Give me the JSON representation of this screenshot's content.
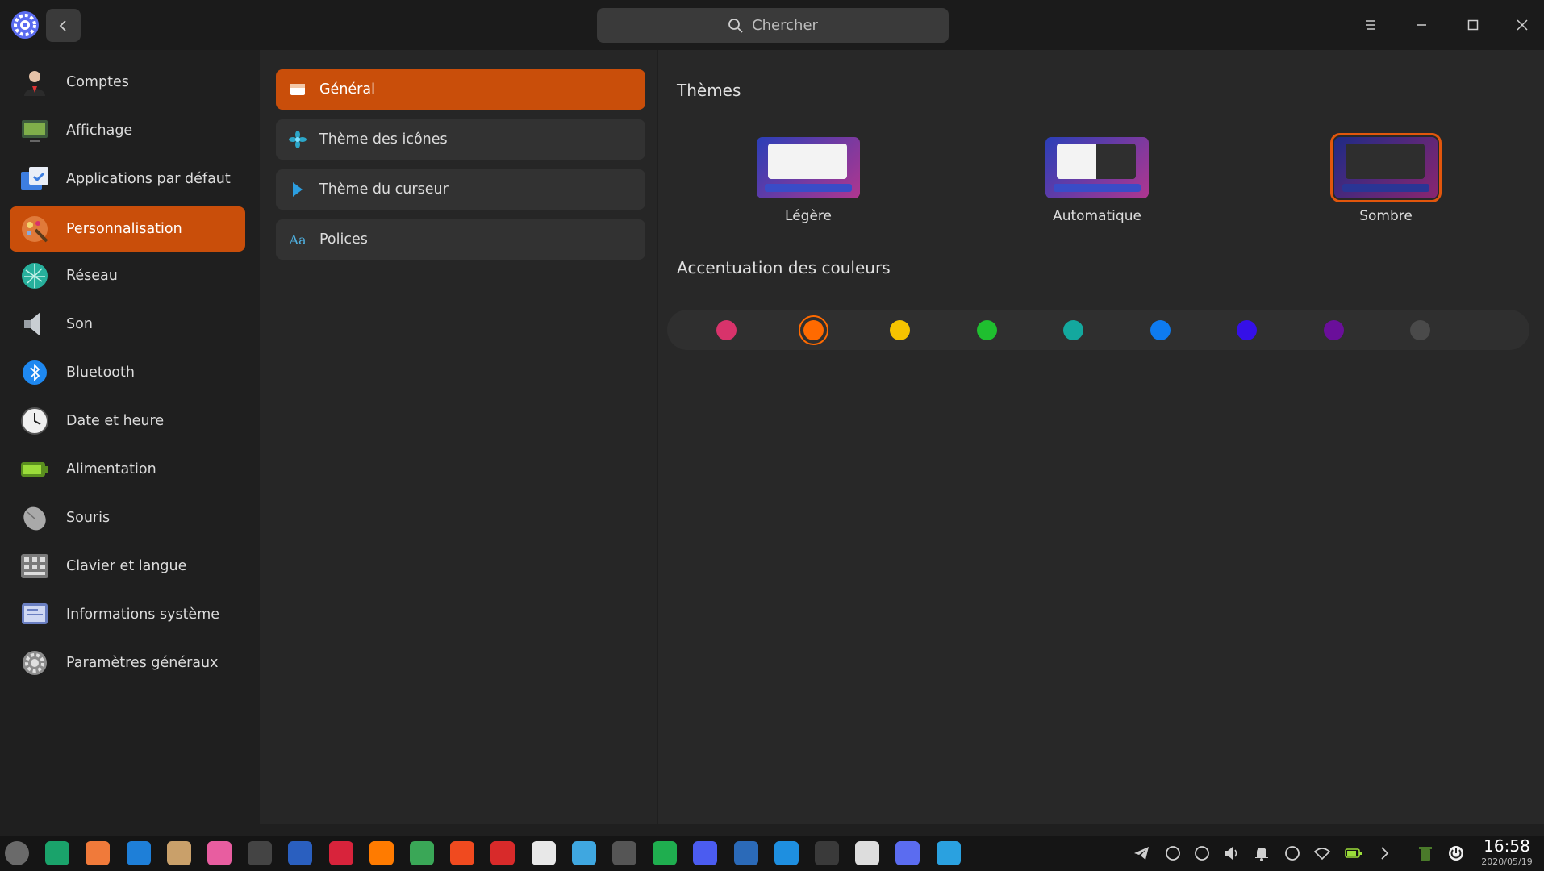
{
  "window": {
    "search_placeholder": "Chercher"
  },
  "sidebar": {
    "items": [
      {
        "label": "Comptes",
        "icon": "user-avatar-icon"
      },
      {
        "label": "Affichage",
        "icon": "display-icon"
      },
      {
        "label": "Applications par défaut",
        "icon": "default-apps-icon"
      },
      {
        "label": "Personnalisation",
        "icon": "personalization-icon"
      },
      {
        "label": "Réseau",
        "icon": "network-icon"
      },
      {
        "label": "Son",
        "icon": "speaker-icon"
      },
      {
        "label": "Bluetooth",
        "icon": "bluetooth-icon"
      },
      {
        "label": "Date et heure",
        "icon": "clock-icon"
      },
      {
        "label": "Alimentation",
        "icon": "battery-icon"
      },
      {
        "label": "Souris",
        "icon": "mouse-icon"
      },
      {
        "label": "Clavier et langue",
        "icon": "keyboard-icon"
      },
      {
        "label": "Informations système",
        "icon": "system-info-icon"
      },
      {
        "label": "Paramètres généraux",
        "icon": "gear-icon"
      }
    ],
    "active_index": 3
  },
  "subnav": {
    "items": [
      {
        "label": "Général",
        "icon": "window-icon"
      },
      {
        "label": "Thème des icônes",
        "icon": "flower-icon"
      },
      {
        "label": "Thème du curseur",
        "icon": "cursor-icon"
      },
      {
        "label": "Polices",
        "icon": "font-icon"
      }
    ],
    "active_index": 0
  },
  "themes": {
    "title": "Thèmes",
    "options": [
      {
        "label": "Légère"
      },
      {
        "label": "Automatique"
      },
      {
        "label": "Sombre"
      }
    ],
    "selected_index": 2
  },
  "accent": {
    "title": "Accentuation des couleurs",
    "colors": [
      "#d8336b",
      "#ff6a00",
      "#f5c300",
      "#1fbf2f",
      "#13a89e",
      "#0e7bf0",
      "#3510e8",
      "#6a0f9a",
      "#4a4a4a"
    ],
    "selected_index": 1
  },
  "taskbar": {
    "time": "16:58",
    "date": "2020/05/19"
  },
  "colors": {
    "accent": "#c94e0a"
  }
}
